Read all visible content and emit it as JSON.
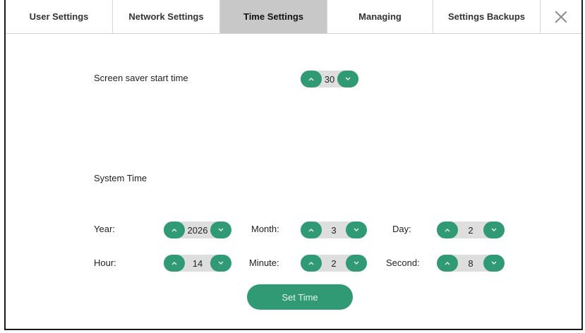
{
  "tabs": [
    {
      "label": "User Settings"
    },
    {
      "label": "Network Settings"
    },
    {
      "label": "Time Settings"
    },
    {
      "label": "Managing"
    },
    {
      "label": "Settings Backups"
    }
  ],
  "screen_saver": {
    "label": "Screen saver start time",
    "value": "30"
  },
  "system_time": {
    "heading": "System Time",
    "year": {
      "label": "Year:",
      "value": "2026"
    },
    "month": {
      "label": "Month:",
      "value": "3"
    },
    "day": {
      "label": "Day:",
      "value": "2"
    },
    "hour": {
      "label": "Hour:",
      "value": "14"
    },
    "minute": {
      "label": "Minute:",
      "value": "2"
    },
    "second": {
      "label": "Second:",
      "value": "8"
    }
  },
  "set_time_label": "Set Time",
  "colors": {
    "accent": "#2f9a73",
    "active_tab": "#c8c8c8",
    "spinner_track": "#dedede"
  },
  "icons": {
    "up": "chevron-up-icon",
    "down": "chevron-down-icon",
    "close": "close-icon"
  }
}
